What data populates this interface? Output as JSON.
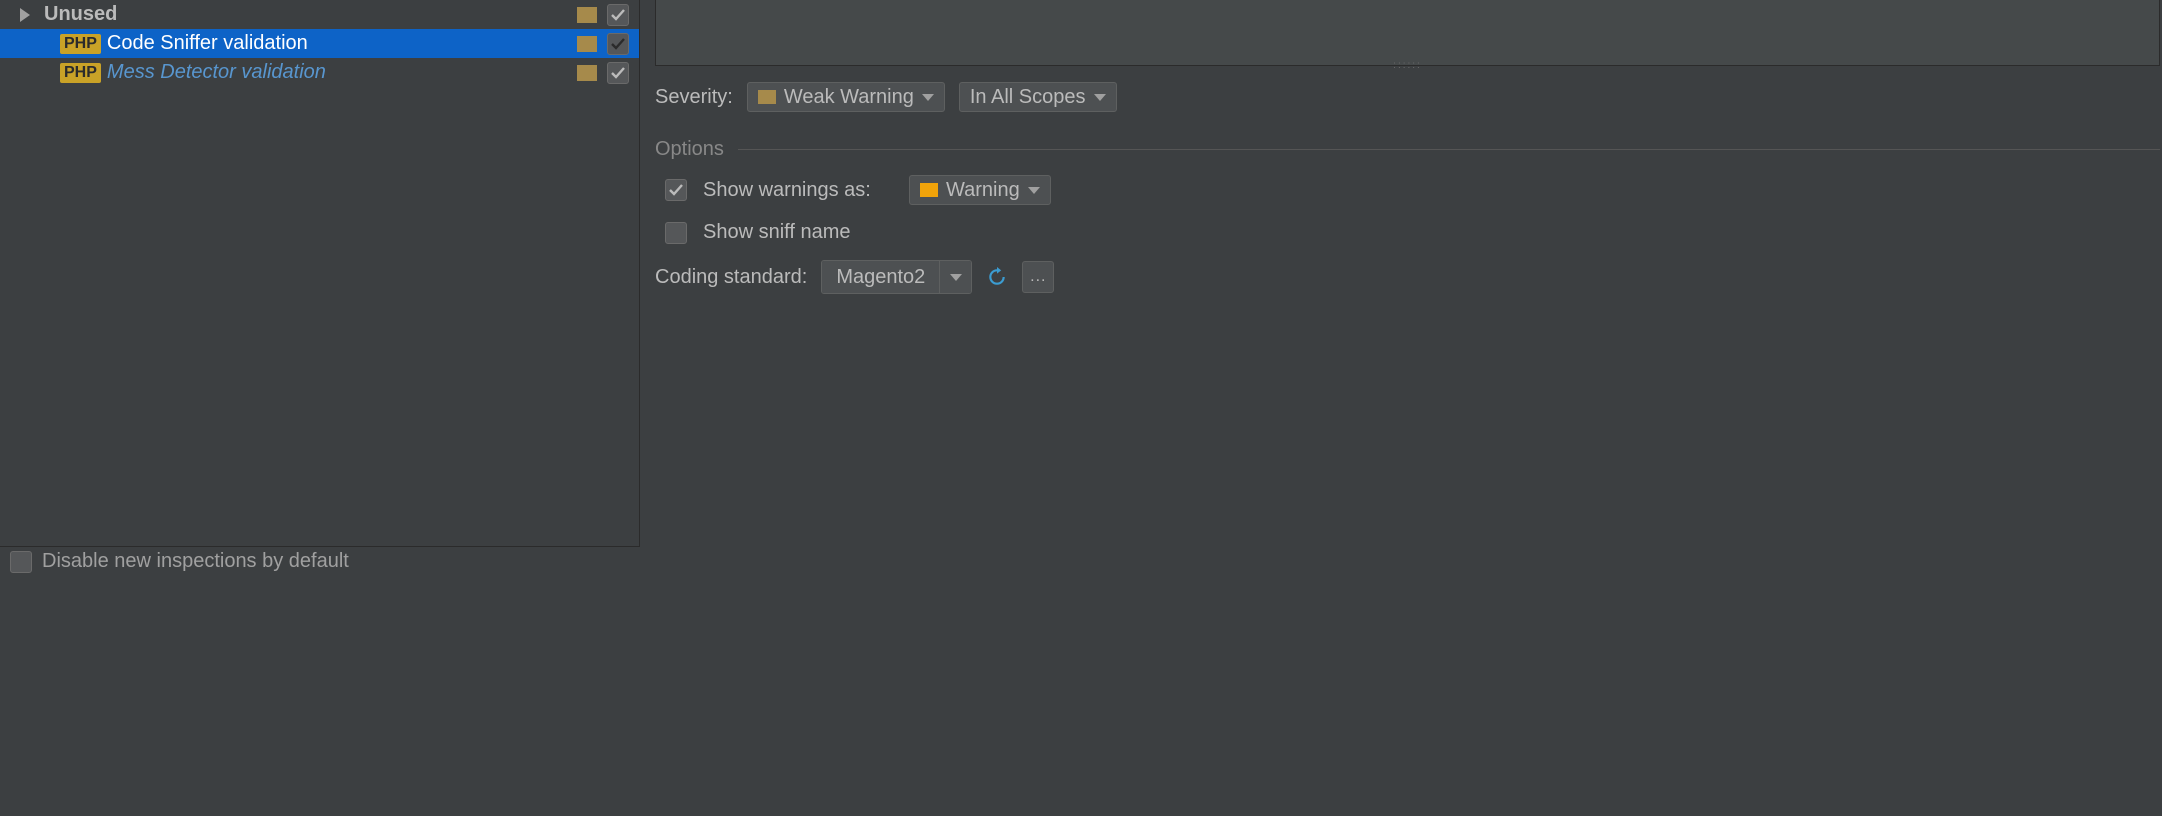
{
  "tree": {
    "category_label": "Unused",
    "items": [
      {
        "badge": "PHP",
        "label": "Code Sniffer validation",
        "selected": true
      },
      {
        "badge": "PHP",
        "label": "Mess Detector validation",
        "modified": true
      }
    ]
  },
  "disable_new_inspections_label": "Disable new inspections by default",
  "right": {
    "severity_label": "Severity:",
    "severity_value": "Weak Warning",
    "scope_value": "In All Scopes",
    "options_label": "Options",
    "show_warnings_as_label": "Show warnings as:",
    "show_warnings_as_value": "Warning",
    "show_sniff_name_label": "Show sniff name",
    "coding_standard_label": "Coding standard:",
    "coding_standard_value": "Magento2",
    "browse_label": "..."
  }
}
